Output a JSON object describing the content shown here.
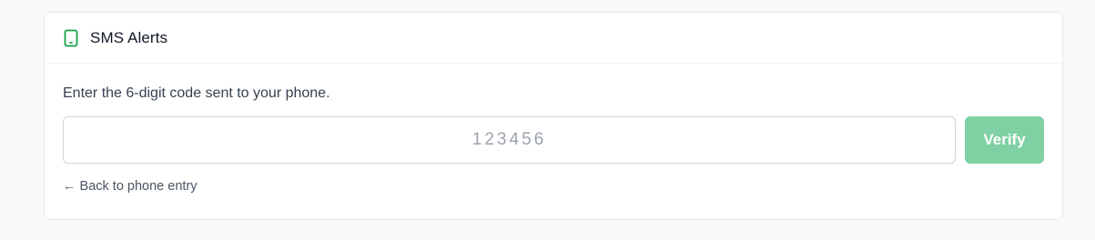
{
  "card": {
    "title": "SMS Alerts",
    "icon": "phone-icon"
  },
  "verify": {
    "instructions": "Enter the 6-digit code sent to your phone.",
    "code_value": "",
    "code_placeholder": "123456",
    "button_label": "Verify",
    "button_state": "disabled",
    "back_link": "← Back to phone entry"
  },
  "colors": {
    "accent": "#16a34a",
    "button_disabled": "#7fd1a4"
  }
}
